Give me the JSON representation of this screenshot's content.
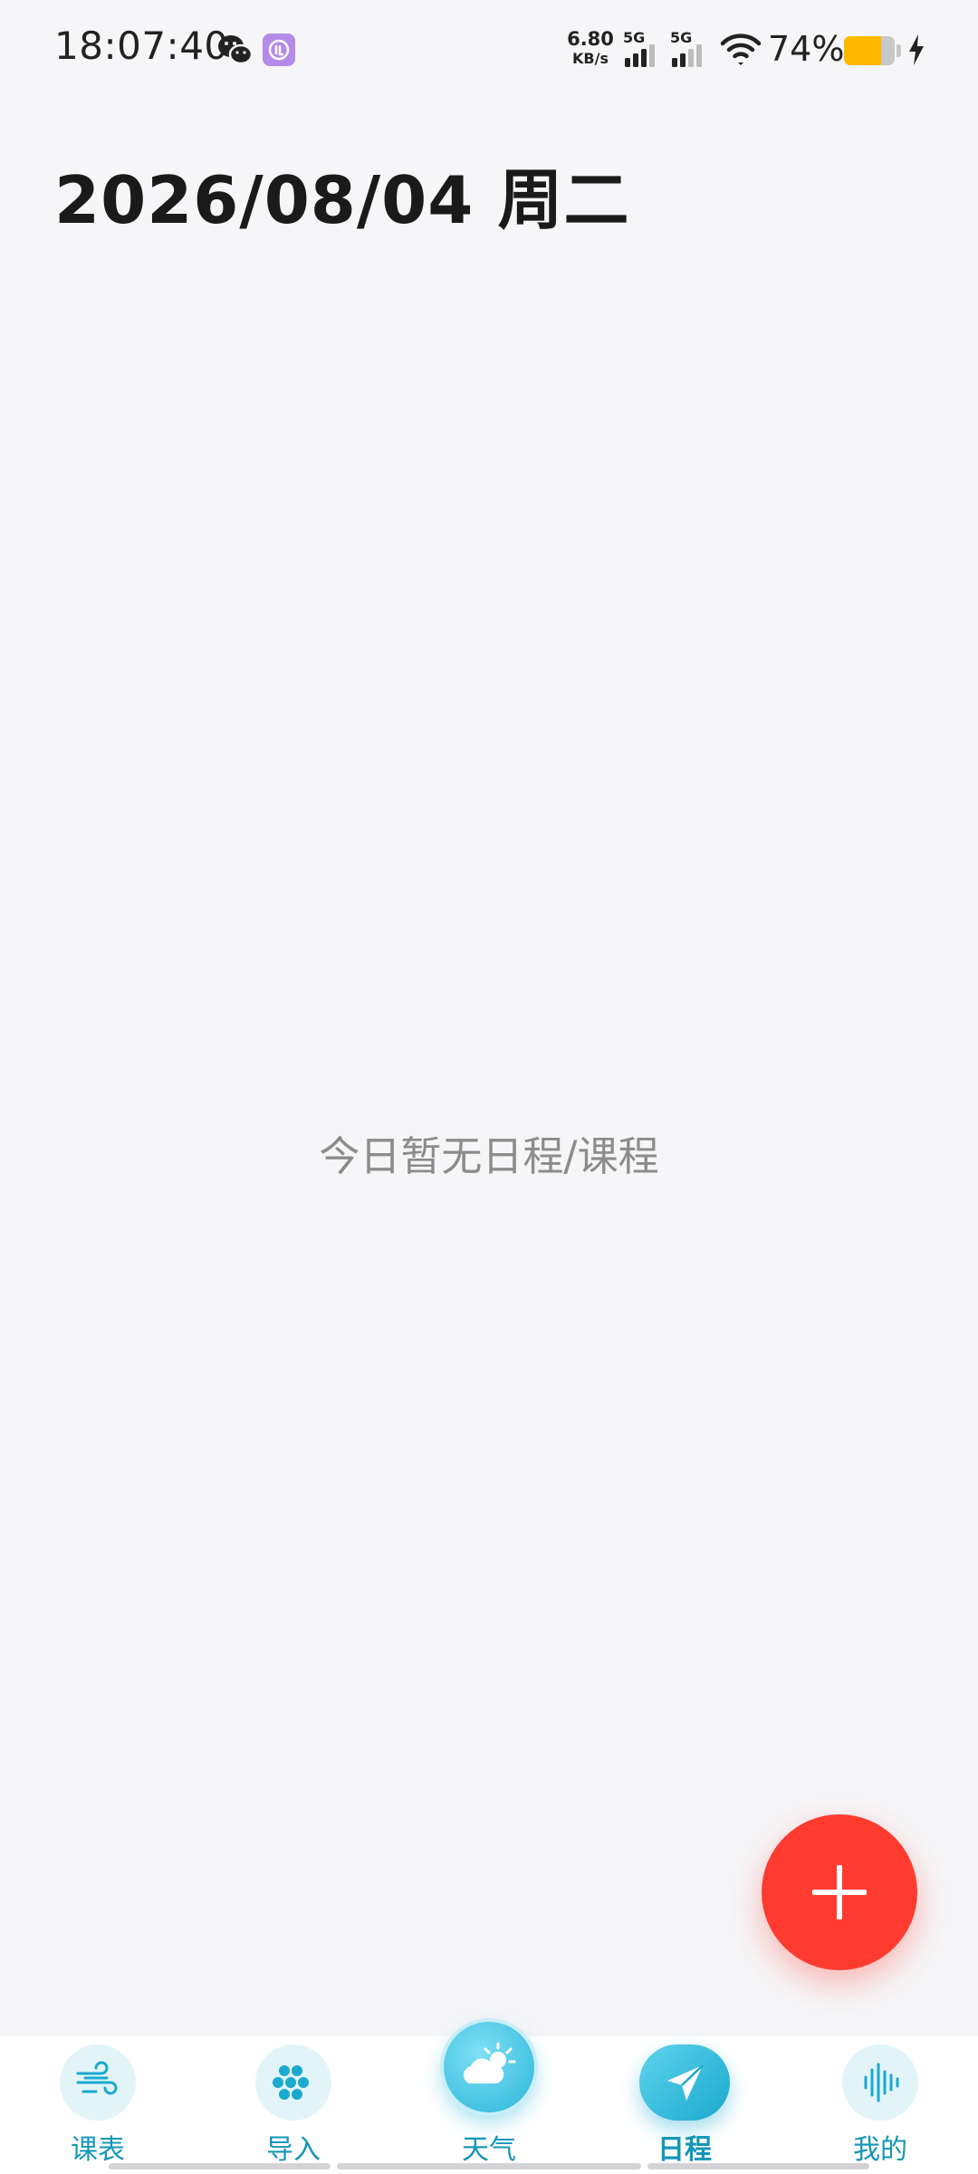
{
  "status_bar": {
    "time": "18:07:40",
    "net_speed_value": "6.80",
    "net_speed_unit": "KB/s",
    "signal_1_label": "5G",
    "signal_2_label": "5G",
    "battery_percent": "74%",
    "battery_level": 0.74,
    "icons": [
      "wechat-icon",
      "app-notification-icon",
      "signal-icon",
      "wifi-icon",
      "battery-icon",
      "charging-icon"
    ]
  },
  "header": {
    "title": "2026/08/04 周二"
  },
  "main": {
    "empty_message": "今日暂无日程/课程"
  },
  "fab": {
    "icon": "plus-icon",
    "color": "#ff3b30"
  },
  "bottom_nav": {
    "accent_color": "#1496b8",
    "items": [
      {
        "label": "课表",
        "icon": "wind-icon"
      },
      {
        "label": "导入",
        "icon": "dots-grid-icon"
      },
      {
        "label": "天气",
        "icon": "weather-icon"
      },
      {
        "label": "日程",
        "icon": "paper-plane-icon"
      },
      {
        "label": "我的",
        "icon": "sound-wave-icon"
      }
    ]
  }
}
